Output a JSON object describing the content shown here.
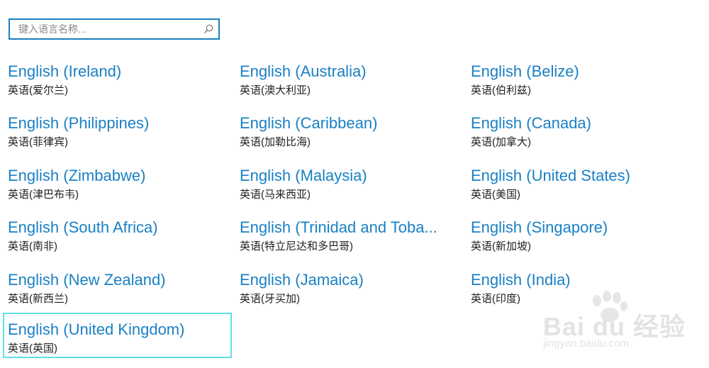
{
  "search": {
    "placeholder": "键入语言名称..."
  },
  "languages": [
    {
      "name": "English (Ireland)",
      "native": "英语(爱尔兰)"
    },
    {
      "name": "English (Australia)",
      "native": "英语(澳大利亚)"
    },
    {
      "name": "English (Belize)",
      "native": "英语(伯利兹)"
    },
    {
      "name": "English (Philippines)",
      "native": "英语(菲律宾)"
    },
    {
      "name": "English (Caribbean)",
      "native": "英语(加勒比海)"
    },
    {
      "name": "English (Canada)",
      "native": "英语(加拿大)"
    },
    {
      "name": "English (Zimbabwe)",
      "native": "英语(津巴布韦)"
    },
    {
      "name": "English (Malaysia)",
      "native": "英语(马来西亚)"
    },
    {
      "name": "English (United States)",
      "native": "英语(美国)"
    },
    {
      "name": "English (South Africa)",
      "native": "英语(南非)"
    },
    {
      "name": "English (Trinidad and Toba...",
      "native": "英语(特立尼达和多巴哥)"
    },
    {
      "name": "English (Singapore)",
      "native": "英语(新加坡)"
    },
    {
      "name": "English (New Zealand)",
      "native": "英语(新西兰)"
    },
    {
      "name": "English (Jamaica)",
      "native": "英语(牙买加)"
    },
    {
      "name": "English (India)",
      "native": "英语(印度)"
    },
    {
      "name": "English (United Kingdom)",
      "native": "英语(英国)"
    }
  ],
  "selected_language": "English (United Kingdom)",
  "watermark": {
    "logo": "Bai du 经验",
    "url": "jingyan.baidu.com"
  },
  "colors": {
    "link": "#1a80c4",
    "search_border": "#1a7fc1",
    "selection_border": "#5fe0e6"
  },
  "icons": {
    "search": "search-icon"
  }
}
